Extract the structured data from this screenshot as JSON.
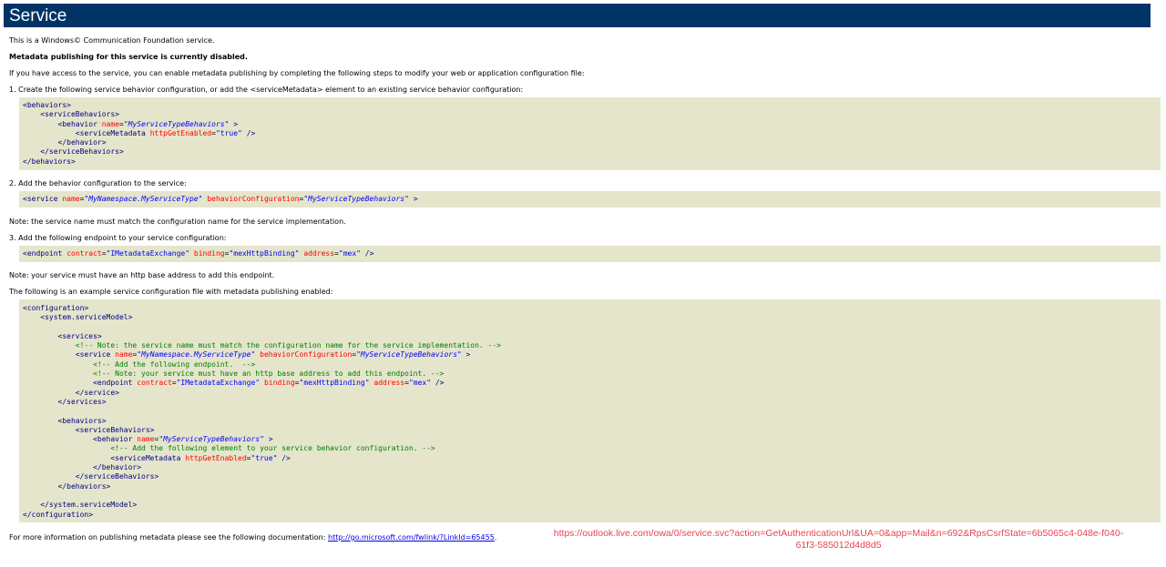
{
  "header": {
    "title": "Service"
  },
  "intro": {
    "wcf": "This is a Windows© Communication Foundation service.",
    "disabled": "Metadata publishing for this service is currently disabled.",
    "access": "If you have access to the service, you can enable metadata publishing by completing the following steps to modify your web or application configuration file:"
  },
  "step1": {
    "text": "1. Create the following service behavior configuration, or add the <serviceMetadata> element to an existing service behavior configuration:",
    "code": {
      "l1": "<behaviors>",
      "l2": "<serviceBehaviors>",
      "l3_tag": "<behavior",
      "l3_attr": "name",
      "l3_val": "\"MyServiceTypeBehaviors\"",
      "l3_end": ">",
      "l4_tag": "<serviceMetadata",
      "l4_attr": "httpGetEnabled",
      "l4_val": "\"true\"",
      "l4_end": "/>",
      "l5": "</behavior>",
      "l6": "</serviceBehaviors>",
      "l7": "</behaviors>"
    }
  },
  "step2": {
    "text": "2. Add the behavior configuration to the service:",
    "code": {
      "tag": "<service",
      "a1": "name",
      "v1": "\"MyNamespace.MyServiceType\"",
      "a2": "behaviorConfiguration",
      "v2": "\"MyServiceTypeBehaviors\"",
      "end": ">"
    }
  },
  "note1": "Note: the service name must match the configuration name for the service implementation.",
  "step3": {
    "text": "3. Add the following endpoint to your service configuration:",
    "code": {
      "tag": "<endpoint",
      "a1": "contract",
      "v1": "\"IMetadataExchange\"",
      "a2": "binding",
      "v2": "\"mexHttpBinding\"",
      "a3": "address",
      "v3": "\"mex\"",
      "end": "/>"
    }
  },
  "note2": "Note: your service must have an http base address to add this endpoint.",
  "example_intro": "The following is an example service configuration file with metadata publishing enabled:",
  "example": {
    "configuration_open": "<configuration>",
    "system_open": "<system.serviceModel>",
    "services_open": "<services>",
    "comment1": "<!-- Note: the service name must match the configuration name for the service implementation. -->",
    "service_tag": "<service",
    "service_a1": "name",
    "service_v1": "\"MyNamespace.MyServiceType\"",
    "service_a2": "behaviorConfiguration",
    "service_v2": "\"MyServiceTypeBehaviors\"",
    "service_end": ">",
    "comment2": "<!-- Add the following endpoint.  -->",
    "comment3": "<!-- Note: your service must have an http base address to add this endpoint. -->",
    "endpoint_tag": "<endpoint",
    "endpoint_a1": "contract",
    "endpoint_v1": "\"IMetadataExchange\"",
    "endpoint_a2": "binding",
    "endpoint_v2": "\"mexHttpBinding\"",
    "endpoint_a3": "address",
    "endpoint_v3": "\"mex\"",
    "endpoint_end": "/>",
    "service_close": "</service>",
    "services_close": "</services>",
    "behaviors_open": "<behaviors>",
    "servicebehaviors_open": "<serviceBehaviors>",
    "behavior_tag": "<behavior",
    "behavior_a": "name",
    "behavior_v": "\"MyServiceTypeBehaviors\"",
    "behavior_end": ">",
    "comment4": "<!-- Add the following element to your service behavior configuration. -->",
    "sm_tag": "<serviceMetadata",
    "sm_a": "httpGetEnabled",
    "sm_v": "\"true\"",
    "sm_end": "/>",
    "behavior_close": "</behavior>",
    "servicebehaviors_close": "</serviceBehaviors>",
    "behaviors_close": "</behaviors>",
    "system_close": "</system.serviceModel>",
    "configuration_close": "</configuration>"
  },
  "footer": {
    "text": "For more information on publishing metadata please see the following documentation: ",
    "link": "http://go.microsoft.com/fwlink/?LinkId=65455",
    "period": "."
  },
  "overlay_url": "https://outlook.live.com/owa/0/service.svc?action=GetAuthenticationUrl&UA=0&app=Mail&n=692&RpsCsrfState=6b5065c4-048e-f040-61f3-585012d4d8d5",
  "colors": {
    "header_bg": "#003366",
    "code_bg": "#e5e5cc",
    "tag": "#000080",
    "attr": "#ff0000",
    "value": "#0000ff",
    "comment": "#008000",
    "overlay": "#e8454f"
  }
}
